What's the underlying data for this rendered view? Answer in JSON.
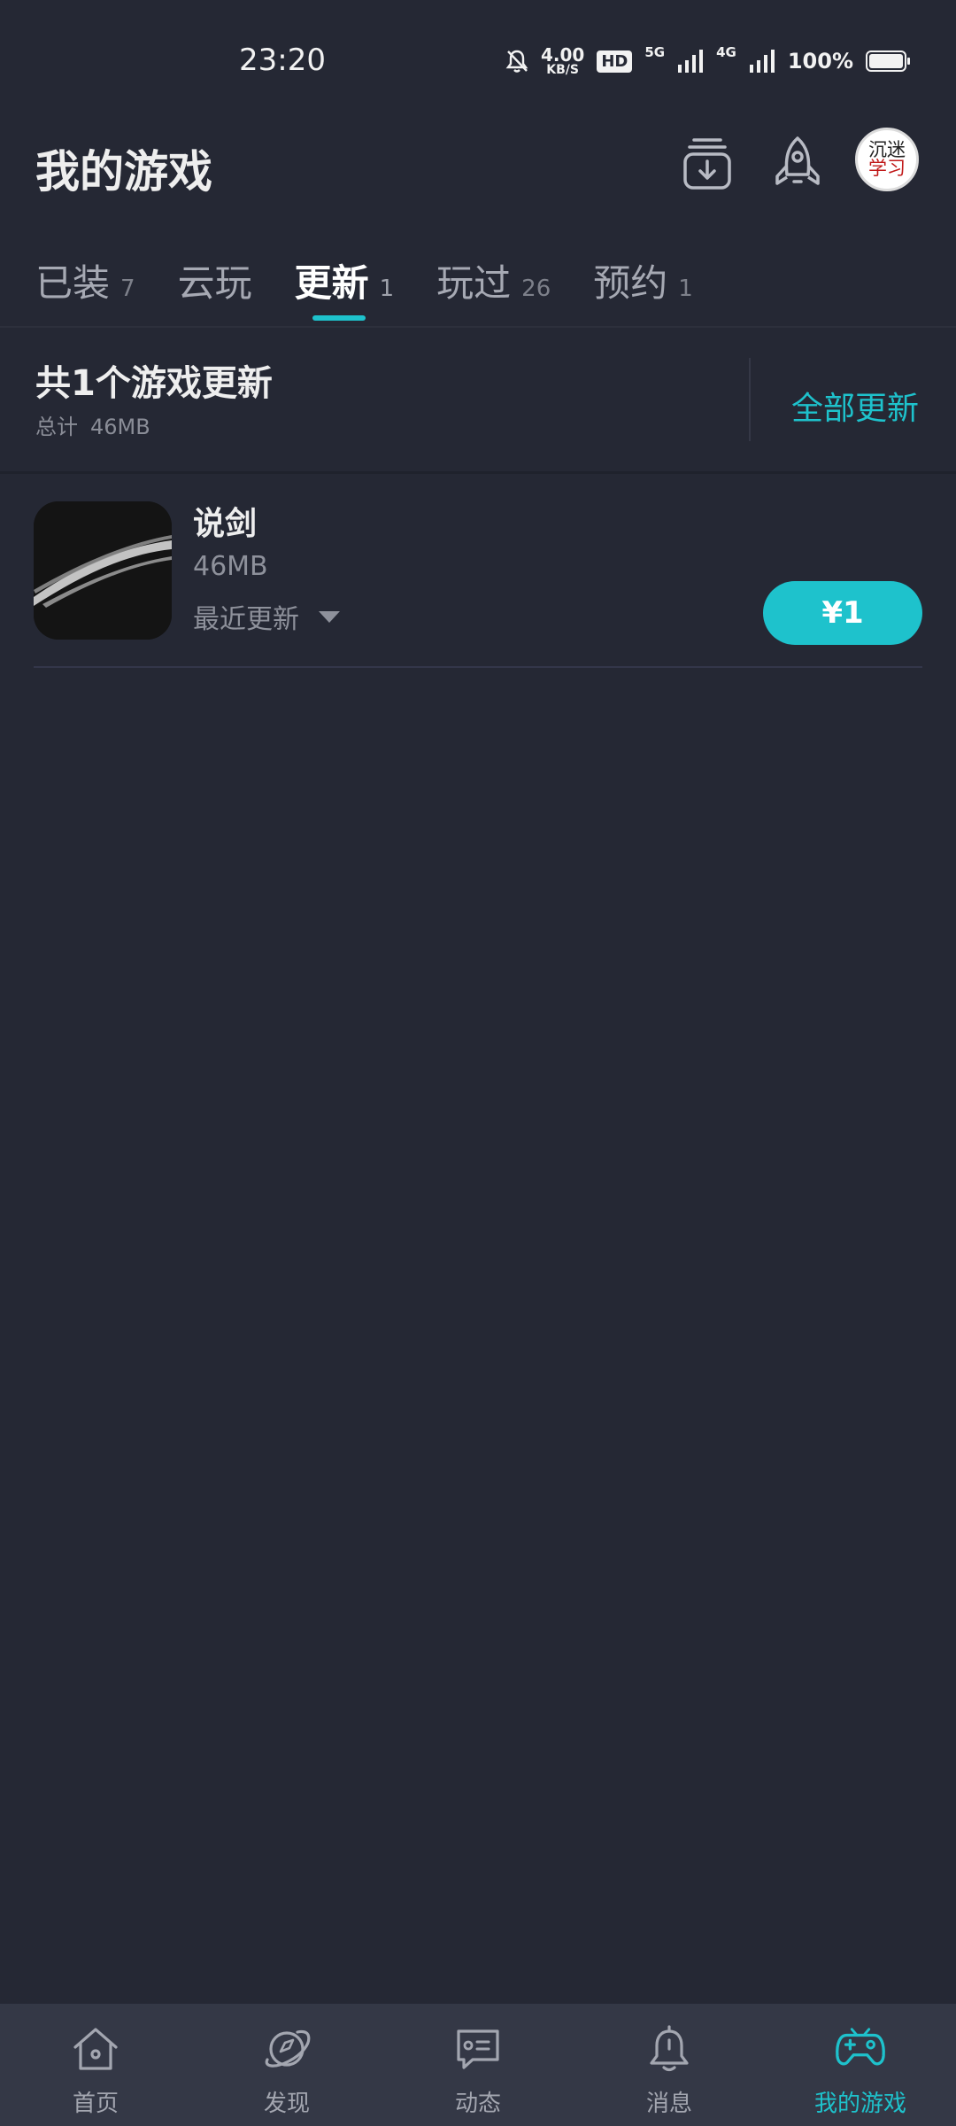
{
  "status_bar": {
    "time": "23:20",
    "net_speed_value": "4.00",
    "net_speed_unit": "KB/S",
    "hd_badge": "HD",
    "net_5g": "5G",
    "net_4g": "4G",
    "battery_text": "100%"
  },
  "header": {
    "title": "我的游戏",
    "avatar_line1": "沉迷",
    "avatar_line2": "学习"
  },
  "tabs": [
    {
      "label": "已装",
      "count": "7",
      "active": false
    },
    {
      "label": "云玩",
      "count": "",
      "active": false
    },
    {
      "label": "更新",
      "count": "1",
      "active": true
    },
    {
      "label": "玩过",
      "count": "26",
      "active": false
    },
    {
      "label": "预约",
      "count": "1",
      "active": false
    }
  ],
  "summary": {
    "title": "共1个游戏更新",
    "total_label": "总计",
    "total_size": "46MB",
    "update_all_label": "全部更新"
  },
  "games": [
    {
      "name": "说剑",
      "size": "46MB",
      "recent_label": "最近更新",
      "price": "¥1"
    }
  ],
  "bottom_nav": [
    {
      "label": "首页",
      "icon": "home-icon",
      "active": false
    },
    {
      "label": "发现",
      "icon": "discover-planet-icon",
      "active": false
    },
    {
      "label": "动态",
      "icon": "feed-message-icon",
      "active": false
    },
    {
      "label": "消息",
      "icon": "bell-icon",
      "active": false
    },
    {
      "label": "我的游戏",
      "icon": "gamepad-icon",
      "active": true
    }
  ],
  "colors": {
    "background": "#252834",
    "accent": "#1ec2cc",
    "nav_background": "#343846"
  }
}
